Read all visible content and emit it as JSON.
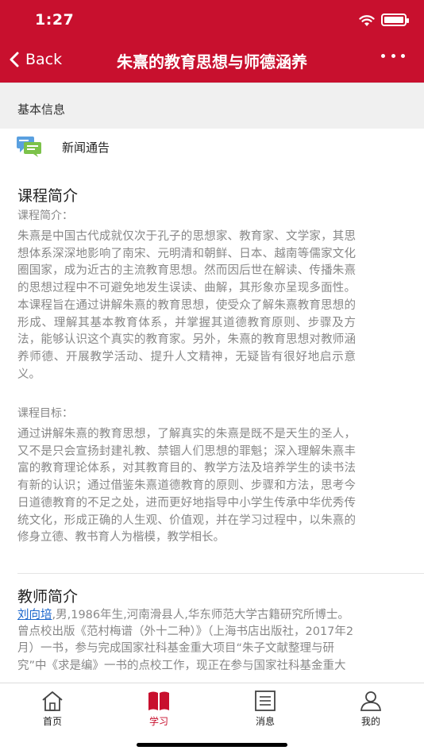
{
  "status_bar": {
    "time": "1:27"
  },
  "nav": {
    "back_label": "Back",
    "title": "朱熹的教育思想与师德涵养"
  },
  "basic_info": {
    "header": "基本信息",
    "news_label": "新闻通告"
  },
  "course_intro": {
    "heading": "课程简介",
    "sub_intro": "课程简介：",
    "intro_text": "朱熹是中国古代成就仅次于孔子的思想家、教育家、文学家，其思想体系深深地影响了南宋、元明清和朝鲜、日本、越南等儒家文化圈国家，成为近古的主流教育思想。然而因后世在解读、传播朱熹的思想过程中不可避免地发生误读、曲解，其形象亦呈现多面性。本课程旨在通过讲解朱熹的教育思想，使受众了解朱熹教育思想的形成、理解其基本教育体系，并掌握其道德教育原则、步骤及方法，能够认识这个真实的教育家。另外，朱熹的教育思想对教师涵养师德、开展教学活动、提升人文精神，无疑皆有很好地启示意义。",
    "sub_goal": "课程目标：",
    "goal_text": "通过讲解朱熹的教育思想，了解真实的朱熹是既不是天生的圣人，又不是只会宣扬封建礼教、禁锢人们思想的罪魁；深入理解朱熹丰富的教育理论体系，对其教育目的、教学方法及培养学生的读书法有新的认识；通过借鉴朱熹道德教育的原则、步骤和方法，思考今日道德教育的不足之处，进而更好地指导中小学生传承中华优秀传统文化，形成正确的人生观、价值观，并在学习过程中，以朱熹的修身立德、教书育人为楷模，教学相长。"
  },
  "teacher_intro": {
    "heading": "教师简介",
    "name": "刘向培",
    "text": ",男,1986年生,河南滑县人,华东师范大学古籍研究所博士。曾点校出版《范村梅谱（外十二种）》（上海书店出版社，2017年2月）一书，参与完成国家社科基金重大项目“朱子文献整理与研究”中《求是编》一书的点校工作，现正在参与国家社科基金重大"
  },
  "tabbar": {
    "items": [
      {
        "label": "首页",
        "icon": "home-icon"
      },
      {
        "label": "学习",
        "icon": "book-icon"
      },
      {
        "label": "消息",
        "icon": "message-icon"
      },
      {
        "label": "我的",
        "icon": "profile-icon"
      }
    ],
    "active_index": 1
  },
  "colors": {
    "accent": "#c8102e",
    "link": "#1a66cc",
    "body_text": "#888888"
  }
}
